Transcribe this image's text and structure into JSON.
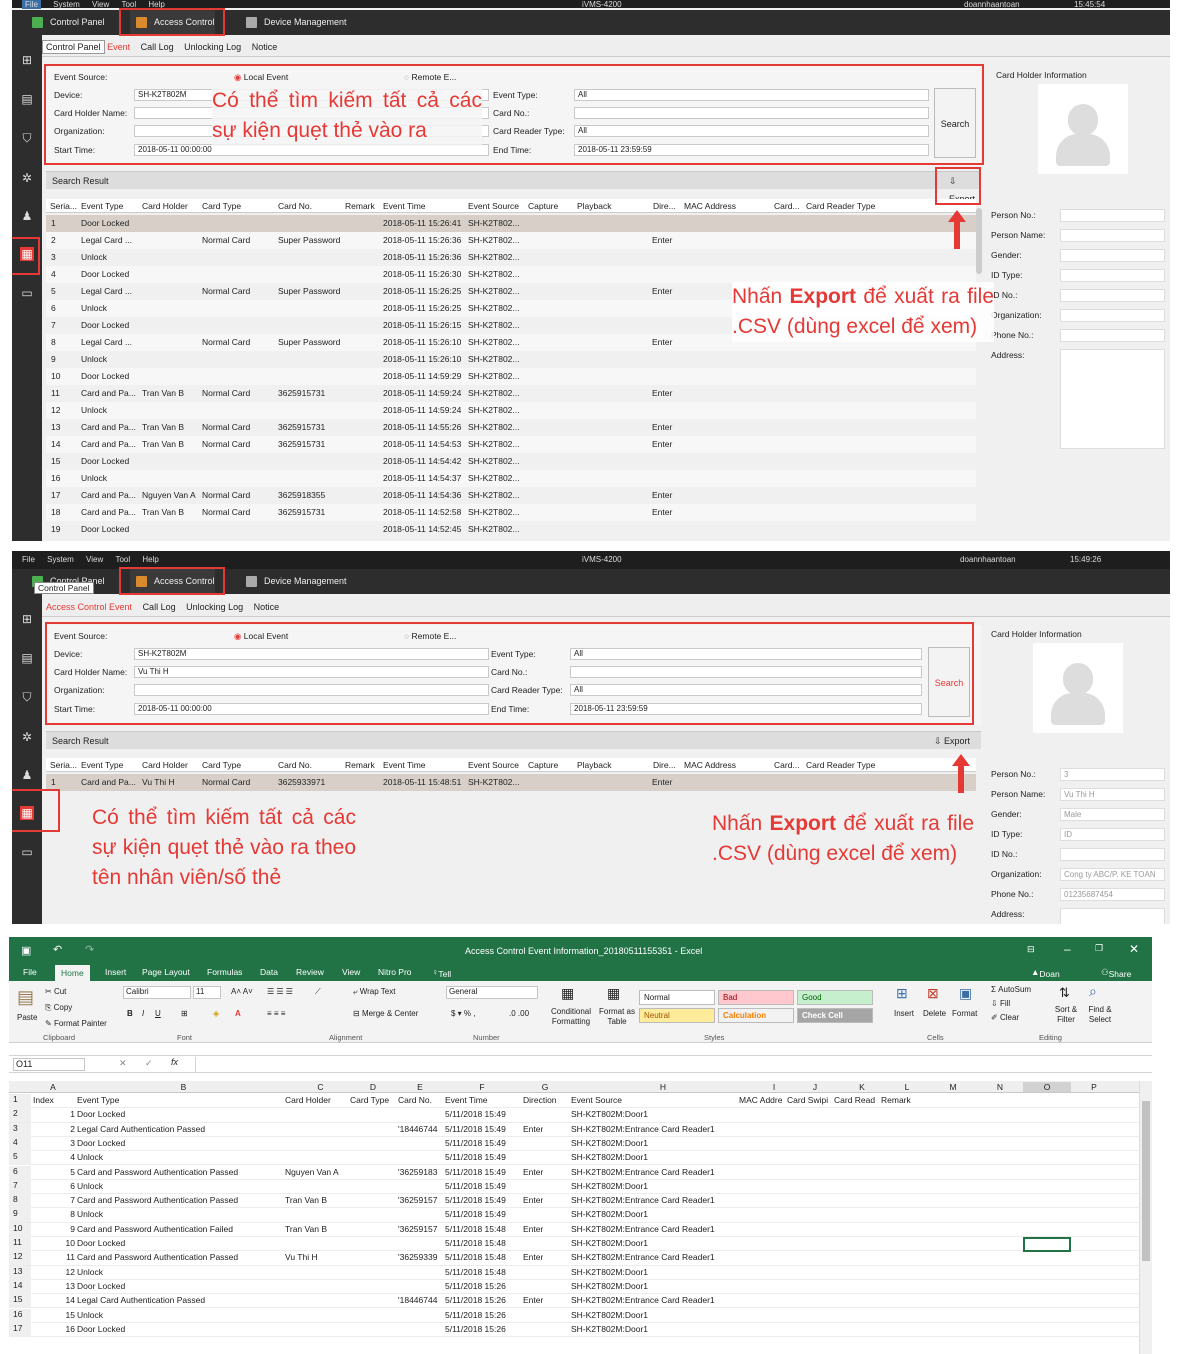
{
  "panel1": {
    "menu": [
      "File",
      "System",
      "View",
      "Tool",
      "Help"
    ],
    "app_title": "iVMS-4200",
    "user": "doannhaantoan",
    "time": "15:45:54",
    "tabs": [
      "Control Panel",
      "Access Control",
      "Device Management"
    ],
    "subtabs": [
      "Control Panel",
      "Event",
      "Call Log",
      "Unlocking Log",
      "Notice"
    ],
    "form": {
      "event_source_label": "Event Source:",
      "local_event": "Local Event",
      "remote_event": "Remote E...",
      "device_label": "Device:",
      "device_value": "SH-K2T802M",
      "card_holder_label": "Card Holder Name:",
      "card_holder_value": "",
      "organization_label": "Organization:",
      "start_time_label": "Start Time:",
      "start_time_value": "2018-05-11 00:00:00",
      "event_type_label": "Event Type:",
      "event_type_value": "All",
      "card_no_label": "Card No.:",
      "card_reader_label": "Card Reader Type:",
      "card_reader_value": "All",
      "end_time_label": "End Time:",
      "end_time_value": "2018-05-11 23:59:59",
      "search_label": "Search"
    },
    "search_result_label": "Search Result",
    "export_label": "Export",
    "columns": [
      "Seria...",
      "Event Type",
      "Card Holder",
      "Card Type",
      "Card No.",
      "Remark",
      "Event Time",
      "Event Source",
      "Capture",
      "Playback",
      "Dire...",
      "MAC Address",
      "Card...",
      "Card Reader Type"
    ],
    "rows": [
      [
        "1",
        "Door Locked",
        "",
        "",
        "",
        "2018-05-11 15:26:41",
        "SH-K2T802...",
        ""
      ],
      [
        "2",
        "Legal Card ...",
        "",
        "Normal Card",
        "Super Password",
        "2018-05-11 15:26:36",
        "SH-K2T802...",
        "Enter"
      ],
      [
        "3",
        "Unlock",
        "",
        "",
        "",
        "2018-05-11 15:26:36",
        "SH-K2T802...",
        ""
      ],
      [
        "4",
        "Door Locked",
        "",
        "",
        "",
        "2018-05-11 15:26:30",
        "SH-K2T802...",
        ""
      ],
      [
        "5",
        "Legal Card ...",
        "",
        "Normal Card",
        "Super Password",
        "2018-05-11 15:26:25",
        "SH-K2T802...",
        "Enter"
      ],
      [
        "6",
        "Unlock",
        "",
        "",
        "",
        "2018-05-11 15:26:25",
        "SH-K2T802...",
        ""
      ],
      [
        "7",
        "Door Locked",
        "",
        "",
        "",
        "2018-05-11 15:26:15",
        "SH-K2T802...",
        ""
      ],
      [
        "8",
        "Legal Card ...",
        "",
        "Normal Card",
        "Super Password",
        "2018-05-11 15:26:10",
        "SH-K2T802...",
        "Enter"
      ],
      [
        "9",
        "Unlock",
        "",
        "",
        "",
        "2018-05-11 15:26:10",
        "SH-K2T802...",
        ""
      ],
      [
        "10",
        "Door Locked",
        "",
        "",
        "",
        "2018-05-11 14:59:29",
        "SH-K2T802...",
        ""
      ],
      [
        "11",
        "Card and Pa...",
        "Tran Van B",
        "Normal Card",
        "3625915731",
        "2018-05-11 14:59:24",
        "SH-K2T802...",
        "Enter"
      ],
      [
        "12",
        "Unlock",
        "",
        "",
        "",
        "2018-05-11 14:59:24",
        "SH-K2T802...",
        ""
      ],
      [
        "13",
        "Card and Pa...",
        "Tran Van B",
        "Normal Card",
        "3625915731",
        "2018-05-11 14:55:26",
        "SH-K2T802...",
        "Enter"
      ],
      [
        "14",
        "Card and Pa...",
        "Tran Van B",
        "Normal Card",
        "3625915731",
        "2018-05-11 14:54:53",
        "SH-K2T802...",
        "Enter"
      ],
      [
        "15",
        "Door Locked",
        "",
        "",
        "",
        "2018-05-11 14:54:42",
        "SH-K2T802...",
        ""
      ],
      [
        "16",
        "Unlock",
        "",
        "",
        "",
        "2018-05-11 14:54:37",
        "SH-K2T802...",
        ""
      ],
      [
        "17",
        "Card and Pa...",
        "Nguyen Van A",
        "Normal Card",
        "3625918355",
        "2018-05-11 14:54:36",
        "SH-K2T802...",
        "Enter"
      ],
      [
        "18",
        "Card and Pa...",
        "Tran Van B",
        "Normal Card",
        "3625915731",
        "2018-05-11 14:52:58",
        "SH-K2T802...",
        "Enter"
      ],
      [
        "19",
        "Door Locked",
        "",
        "",
        "",
        "2018-05-11 14:52:45",
        "SH-K2T802...",
        ""
      ]
    ],
    "side": {
      "title": "Card Holder Information",
      "labels": [
        "Person No.:",
        "Person Name:",
        "Gender:",
        "ID Type:",
        "ID No.:",
        "Organization:",
        "Phone No.:",
        "Address:"
      ],
      "values": [
        "",
        "",
        "",
        "",
        "",
        "",
        "",
        ""
      ]
    },
    "note_search": "Có thể tìm kiếm tất cả các sự kiện quẹt thẻ vào ra",
    "note_export_pre": "Nhấn ",
    "note_export_bold": "Export",
    "note_export_post": " để xuất ra file .CSV (dùng excel để xem)"
  },
  "panel2": {
    "menu": [
      "File",
      "System",
      "View",
      "Tool",
      "Help"
    ],
    "app_title": "iVMS-4200",
    "user": "doannhaantoan",
    "time": "15:49:26",
    "tabs": [
      "Control Panel",
      "Access Control",
      "Device Management"
    ],
    "tooltip": "Control Panel",
    "subtabs": [
      "Access Control Event",
      "Call Log",
      "Unlocking Log",
      "Notice"
    ],
    "form": {
      "event_source_label": "Event Source:",
      "local_event": "Local Event",
      "remote_event": "Remote E...",
      "device_label": "Device:",
      "device_value": "SH-K2T802M",
      "card_holder_label": "Card Holder Name:",
      "card_holder_value": "Vu Thi H",
      "organization_label": "Organization:",
      "start_time_label": "Start Time:",
      "start_time_value": "2018-05-11 00:00:00",
      "event_type_label": "Event Type:",
      "event_type_value": "All",
      "card_no_label": "Card No.:",
      "card_reader_label": "Card Reader Type:",
      "card_reader_value": "All",
      "end_time_label": "End Time:",
      "end_time_value": "2018-05-11 23:59:59",
      "search_label": "Search"
    },
    "search_result_label": "Search Result",
    "export_label": "Export",
    "columns": [
      "Seria...",
      "Event Type",
      "Card Holder",
      "Card Type",
      "Card No.",
      "Remark",
      "Event Time",
      "Event Source",
      "Capture",
      "Playback",
      "Dire...",
      "MAC Address",
      "Card...",
      "Card Reader Type"
    ],
    "rows": [
      [
        "1",
        "Card and Pa...",
        "Vu Thi H",
        "Normal Card",
        "3625933971",
        "2018-05-11 15:48:51",
        "SH-K2T802...",
        "Enter"
      ]
    ],
    "side": {
      "title": "Card Holder Information",
      "labels": [
        "Person No.:",
        "Person Name:",
        "Gender:",
        "ID Type:",
        "ID No.:",
        "Organization:",
        "Phone No.:",
        "Address:"
      ],
      "values": [
        "3",
        "Vu Thi H",
        "Male",
        "ID",
        "",
        "Cong ty ABC/P. KE TOAN",
        "01235687454",
        ""
      ]
    },
    "note_search": "Có thể tìm kiếm tất cả các sự kiện quẹt thẻ vào ra theo tên nhân viên/số thẻ",
    "note_export_pre": "Nhấn ",
    "note_export_bold": "Export",
    "note_export_post": " để xuất ra file .CSV (dùng excel để xem)"
  },
  "excel": {
    "title": "Access Control Event Information_20180511155351 - Excel",
    "user": "Doan Pham",
    "share": "Share",
    "tabs": [
      "File",
      "Home",
      "Insert",
      "Page Layout",
      "Formulas",
      "Data",
      "Review",
      "View",
      "Nitro Pro"
    ],
    "tell_me": "Tell me what you want to do...",
    "ribbon": {
      "paste": "Paste",
      "cut": "Cut",
      "copy": "Copy",
      "format_painter": "Format Painter",
      "clipboard": "Clipboard",
      "font_name": "Calibri",
      "font_size": "11",
      "font": "Font",
      "wrap_text": "Wrap Text",
      "merge_center": "Merge & Center",
      "alignment": "Alignment",
      "number_format": "General",
      "number": "Number",
      "conditional": "Conditional Formatting",
      "format_as_table": "Format as Table",
      "style_normal": "Normal",
      "style_bad": "Bad",
      "style_good": "Good",
      "style_neutral": "Neutral",
      "style_calculation": "Calculation",
      "style_check": "Check Cell",
      "styles": "Styles",
      "insert": "Insert",
      "delete": "Delete",
      "format": "Format",
      "cells": "Cells",
      "autosum": "AutoSum",
      "fill": "Fill",
      "clear": "Clear",
      "sort_filter": "Sort & Filter",
      "find_select": "Find & Select",
      "editing": "Editing"
    },
    "name_box": "O11",
    "columns": [
      "A",
      "B",
      "C",
      "D",
      "E",
      "F",
      "G",
      "H",
      "I",
      "J",
      "K",
      "L",
      "M",
      "N",
      "O",
      "P"
    ],
    "header_row": [
      "Index",
      "Event Type",
      "Card Holder",
      "Card Type",
      "Card No.",
      "Event Time",
      "Direction",
      "Event Source",
      "MAC Addre",
      "Card Swipi",
      "Card Read",
      "Remark"
    ],
    "rows": [
      [
        "1",
        "Door Locked",
        "",
        "",
        "",
        "5/11/2018 15:49",
        "",
        "SH-K2T802M:Door1"
      ],
      [
        "2",
        "Legal Card Authentication Passed",
        "",
        "",
        "'18446744",
        "5/11/2018 15:49",
        "Enter",
        "SH-K2T802M:Entrance Card Reader1"
      ],
      [
        "3",
        "Door Locked",
        "",
        "",
        "",
        "5/11/2018 15:49",
        "",
        "SH-K2T802M:Door1"
      ],
      [
        "4",
        "Unlock",
        "",
        "",
        "",
        "5/11/2018 15:49",
        "",
        "SH-K2T802M:Door1"
      ],
      [
        "5",
        "Card and Password Authentication Passed",
        "Nguyen Van A",
        "",
        "'36259183",
        "5/11/2018 15:49",
        "Enter",
        "SH-K2T802M:Entrance Card Reader1"
      ],
      [
        "6",
        "Unlock",
        "",
        "",
        "",
        "5/11/2018 15:49",
        "",
        "SH-K2T802M:Door1"
      ],
      [
        "7",
        "Card and Password Authentication Passed",
        "Tran Van B",
        "",
        "'36259157",
        "5/11/2018 15:49",
        "Enter",
        "SH-K2T802M:Entrance Card Reader1"
      ],
      [
        "8",
        "Unlock",
        "",
        "",
        "",
        "5/11/2018 15:49",
        "",
        "SH-K2T802M:Door1"
      ],
      [
        "9",
        "Card and Password Authentication Failed",
        "Tran Van B",
        "",
        "'36259157",
        "5/11/2018 15:48",
        "Enter",
        "SH-K2T802M:Entrance Card Reader1"
      ],
      [
        "10",
        "Door Locked",
        "",
        "",
        "",
        "5/11/2018 15:48",
        "",
        "SH-K2T802M:Door1"
      ],
      [
        "11",
        "Card and Password Authentication Passed",
        "Vu Thi H",
        "",
        "'36259339",
        "5/11/2018 15:48",
        "Enter",
        "SH-K2T802M:Entrance Card Reader1"
      ],
      [
        "12",
        "Unlock",
        "",
        "",
        "",
        "5/11/2018 15:48",
        "",
        "SH-K2T802M:Door1"
      ],
      [
        "13",
        "Door Locked",
        "",
        "",
        "",
        "5/11/2018 15:26",
        "",
        "SH-K2T802M:Door1"
      ],
      [
        "14",
        "Legal Card Authentication Passed",
        "",
        "",
        "'18446744",
        "5/11/2018 15:26",
        "Enter",
        "SH-K2T802M:Entrance Card Reader1"
      ],
      [
        "15",
        "Unlock",
        "",
        "",
        "",
        "5/11/2018 15:26",
        "",
        "SH-K2T802M:Door1"
      ],
      [
        "16",
        "Door Locked",
        "",
        "",
        "",
        "5/11/2018 15:26",
        "",
        "SH-K2T802M:Door1"
      ]
    ]
  }
}
